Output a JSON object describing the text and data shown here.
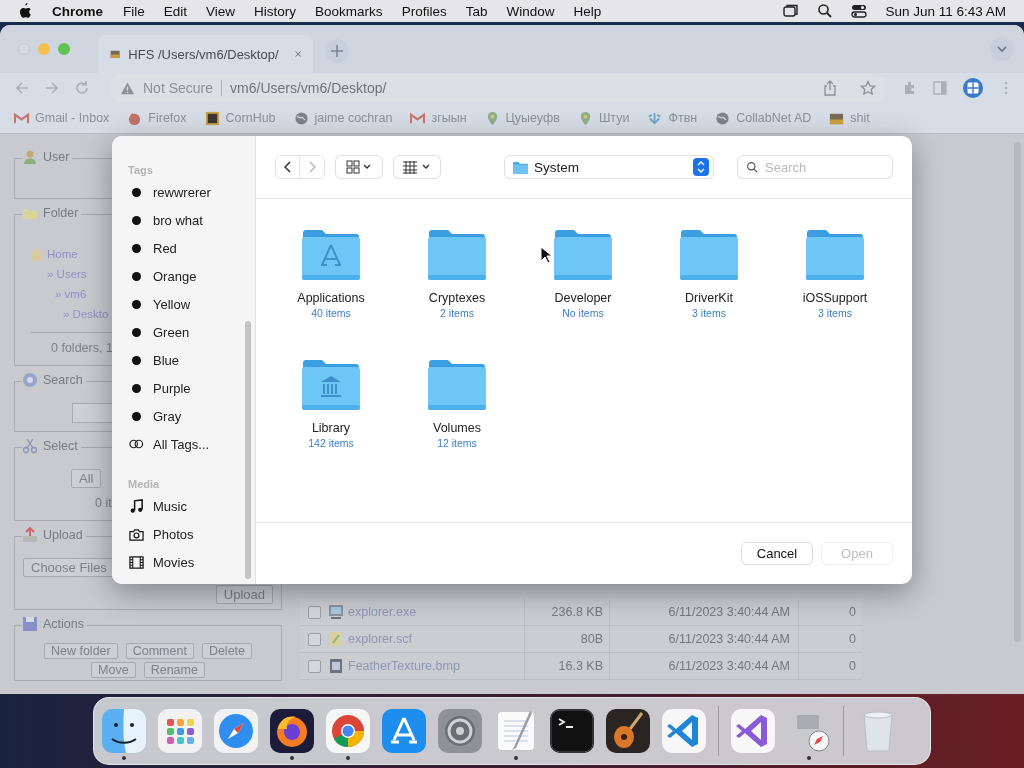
{
  "menubar": {
    "app": "Chrome",
    "menus": [
      "File",
      "Edit",
      "View",
      "History",
      "Bookmarks",
      "Profiles",
      "Tab",
      "Window",
      "Help"
    ],
    "clock": "Sun Jun 11  6:43 AM"
  },
  "browser": {
    "tab": {
      "title": "HFS /Users/vm6/Desktop/"
    },
    "security": "Not Secure",
    "url": "vm6/Users/vm6/Desktop/",
    "bookmarks": [
      {
        "label": "Gmail - Inbox",
        "kind": "mail"
      },
      {
        "label": "Firefox",
        "kind": "fox"
      },
      {
        "label": "CornHub",
        "kind": "ch"
      },
      {
        "label": "jaime cochran",
        "kind": "globe"
      },
      {
        "label": "згыын",
        "kind": "mail"
      },
      {
        "label": "Цуыеуфв",
        "kind": "pin"
      },
      {
        "label": "Штуи",
        "kind": "pin"
      },
      {
        "label": "Фтвн",
        "kind": "arrow"
      },
      {
        "label": "CollabNet AD",
        "kind": "globe"
      },
      {
        "label": "shit",
        "kind": "hfs"
      }
    ]
  },
  "page": {
    "user_panel": {
      "title": "User"
    },
    "folder_panel": {
      "title": "Folder",
      "path": [
        {
          "label": "Home",
          "children": [
            {
              "label": "» Users",
              "children": [
                {
                  "label": "» vm6",
                  "children": [
                    {
                      "label": "» Deskto"
                    }
                  ]
                }
              ]
            }
          ]
        }
      ],
      "summary": "0 folders, 1"
    },
    "search_panel": {
      "title": "Search"
    },
    "select_panel": {
      "title": "Select",
      "button": "All",
      "summary": "0 it"
    },
    "upload_panel": {
      "title": "Upload",
      "choose": "Choose Files",
      "button": "Upload"
    },
    "actions_panel": {
      "title": "Actions",
      "buttons": [
        "New folder",
        "Comment",
        "Delete",
        "Move",
        "Rename"
      ]
    },
    "file_rows": [
      {
        "name": "explorer.exe",
        "size": "236.8 KB",
        "modified": "6/11/2023 3:40:44 AM",
        "column_4": "0",
        "checked": false,
        "kind": "exe"
      },
      {
        "name": "explorer.scf",
        "size": "80B",
        "modified": "6/11/2023 3:40:44 AM",
        "column_4": "0",
        "checked": false,
        "kind": "scf"
      },
      {
        "name": "FeatherTexture.bmp",
        "size": "16.3 KB",
        "modified": "6/11/2023 3:40:44 AM",
        "column_4": "0",
        "checked": false,
        "kind": "bmp"
      }
    ]
  },
  "dialog": {
    "sidebar": [
      {
        "heading": "Tags",
        "items": [
          {
            "label": "rewwrerer",
            "kind": "tag"
          },
          {
            "label": "bro what",
            "kind": "tag"
          },
          {
            "label": "Red",
            "kind": "tag"
          },
          {
            "label": "Orange",
            "kind": "tag"
          },
          {
            "label": "Yellow",
            "kind": "tag"
          },
          {
            "label": "Green",
            "kind": "tag"
          },
          {
            "label": "Blue",
            "kind": "tag"
          },
          {
            "label": "Purple",
            "kind": "tag"
          },
          {
            "label": "Gray",
            "kind": "tag"
          },
          {
            "label": "All Tags...",
            "kind": "all-tags"
          }
        ]
      },
      {
        "heading": "Media",
        "items": [
          {
            "label": "Music",
            "kind": "music"
          },
          {
            "label": "Photos",
            "kind": "photos"
          },
          {
            "label": "Movies",
            "kind": "movies"
          }
        ]
      }
    ],
    "location": "System",
    "search": {
      "placeholder": "Search"
    },
    "folders": [
      {
        "name": "Applications",
        "count": "40 items",
        "kind": "apps"
      },
      {
        "name": "Cryptexes",
        "count": "2 items",
        "kind": "plain"
      },
      {
        "name": "Developer",
        "count": "No items",
        "kind": "plain"
      },
      {
        "name": "DriverKit",
        "count": "3 items",
        "kind": "plain"
      },
      {
        "name": "iOSSupport",
        "count": "3 items",
        "kind": "plain"
      },
      {
        "name": "Library",
        "count": "142 items",
        "kind": "library"
      },
      {
        "name": "Volumes",
        "count": "12 items",
        "kind": "plain"
      }
    ],
    "buttons": [
      {
        "label": "Cancel",
        "disabled": false
      },
      {
        "label": "Open",
        "disabled": true
      }
    ]
  },
  "dock": [
    {
      "kind": "finder",
      "running": true
    },
    {
      "kind": "launchpad",
      "running": false
    },
    {
      "kind": "safari",
      "running": false
    },
    {
      "kind": "firefox",
      "running": true
    },
    {
      "kind": "chrome",
      "running": true
    },
    {
      "kind": "appstore",
      "running": false
    },
    {
      "kind": "settings",
      "running": false
    },
    {
      "kind": "textedit",
      "running": true
    },
    {
      "kind": "terminal",
      "running": false
    },
    {
      "kind": "guitar",
      "running": false
    },
    {
      "kind": "vscode",
      "running": false
    },
    {
      "kind": "separator"
    },
    {
      "kind": "visualstudio",
      "running": false
    },
    {
      "kind": "utility",
      "running": true
    },
    {
      "kind": "separator"
    },
    {
      "kind": "trash",
      "running": false
    }
  ]
}
